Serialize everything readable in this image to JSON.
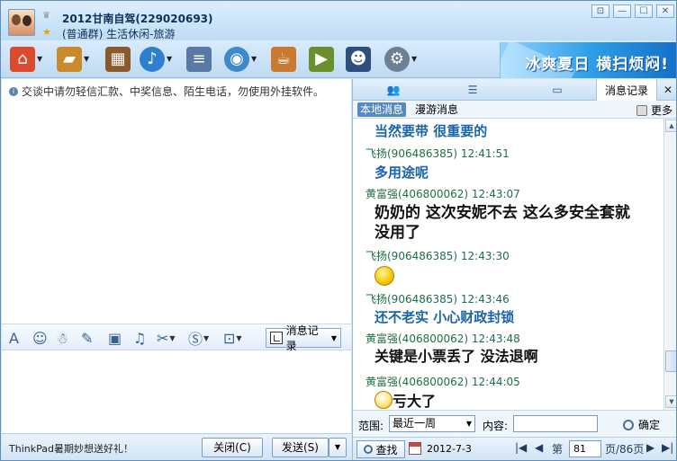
{
  "window": {
    "title": "2012甘南自驾(229020693)",
    "subtitle": "(普通群) 生活休闲-旅游",
    "buttons": [
      "⊡",
      "—",
      "☐",
      "✕"
    ]
  },
  "toolbar": {
    "items": [
      {
        "name": "home-icon",
        "color": "#d94a2f"
      },
      {
        "name": "folder-icon",
        "color": "#c88a2b"
      },
      {
        "name": "album-icon",
        "color": "#8b5a2b"
      },
      {
        "name": "voice-icon",
        "color": "#2f7fd1"
      },
      {
        "name": "notice-icon",
        "color": "#5879a6"
      },
      {
        "name": "camera-icon",
        "color": "#3d8ac8"
      },
      {
        "name": "coffee-icon",
        "color": "#c97a2e"
      },
      {
        "name": "tv-icon",
        "color": "#6a8f2c"
      },
      {
        "name": "police-icon",
        "color": "#2d4f7c"
      },
      {
        "name": "gear-icon",
        "color": "#6d7f95"
      }
    ],
    "banner_text": "冰爽夏日  横扫烦闷!"
  },
  "left": {
    "notice": "交谈中请勿轻信汇款、中奖信息、陌生电话，勿使用外挂软件。",
    "history_button": "消息记录",
    "footer_text": "ThinkPad暑期妙想送好礼！",
    "close_button": "关闭(C)",
    "send_button": "发送(S)"
  },
  "right": {
    "tab_label": "消息记录",
    "subtab_local": "本地消息",
    "subtab_roam": "漫游消息",
    "more_label": "更多",
    "messages": [
      {
        "text": "当然要带 很重要的"
      },
      {
        "sender": "飞扬(906486385) 12:41:51",
        "text": "多用途呢"
      },
      {
        "sender": "黄富强(406800062) 12:43:07",
        "text": "奶奶的   这次安妮不去   这么多安全套就没用了"
      },
      {
        "sender": "飞扬(906486385) 12:43:30"
      },
      {
        "sender": "飞扬(906486385) 12:43:46",
        "text": "还不老实 小心财政封锁"
      },
      {
        "sender": "黄富强(406800062) 12:43:48",
        "text": "关键是小票丢了   没法退啊"
      },
      {
        "sender": "黄富强(406800062) 12:44:05",
        "text": "亏大了"
      }
    ],
    "filter": {
      "range_label": "范围:",
      "range_value": "最近一周",
      "content_label": "内容:",
      "confirm": "确定"
    },
    "pager": {
      "find": "查找",
      "date": "2012-7-3",
      "page_prefix": "第",
      "page_value": "81",
      "page_suffix": "页/86页"
    }
  }
}
